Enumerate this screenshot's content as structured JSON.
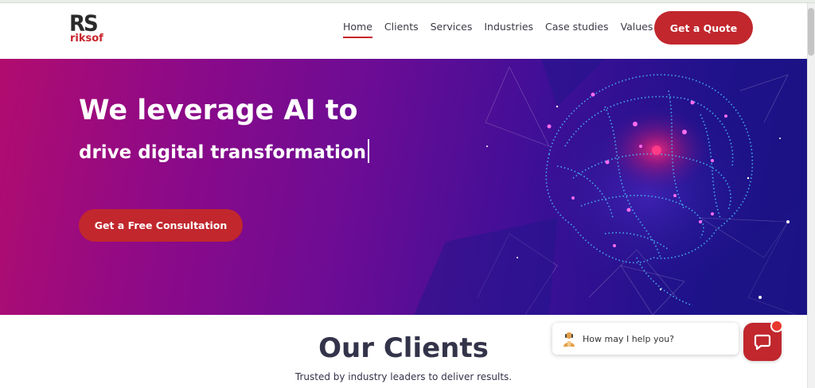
{
  "brand": {
    "logo_mark": "RS",
    "logo_text": "riksof",
    "accent": "#c1272d"
  },
  "nav": {
    "items": [
      {
        "label": "Home",
        "active": true
      },
      {
        "label": "Clients",
        "active": false
      },
      {
        "label": "Services",
        "active": false
      },
      {
        "label": "Industries",
        "active": false
      },
      {
        "label": "Case studies",
        "active": false
      },
      {
        "label": "Values",
        "active": false
      }
    ],
    "cta_label": "Get a Quote"
  },
  "hero": {
    "title": "We leverage AI to",
    "subtitle": "drive digital transformation",
    "cta_label": "Get a Free Consultation",
    "background_colors": [
      "#b10c6f",
      "#6a0c95",
      "#1a1283"
    ],
    "image": "brain-network-illustration"
  },
  "clients": {
    "title": "Our Clients",
    "subtitle": "Trusted by industry leaders to deliver results."
  },
  "chat": {
    "prompt": "How may I help you?",
    "avatar_icon": "agent-avatar-icon",
    "launcher_icon": "chat-icon"
  }
}
